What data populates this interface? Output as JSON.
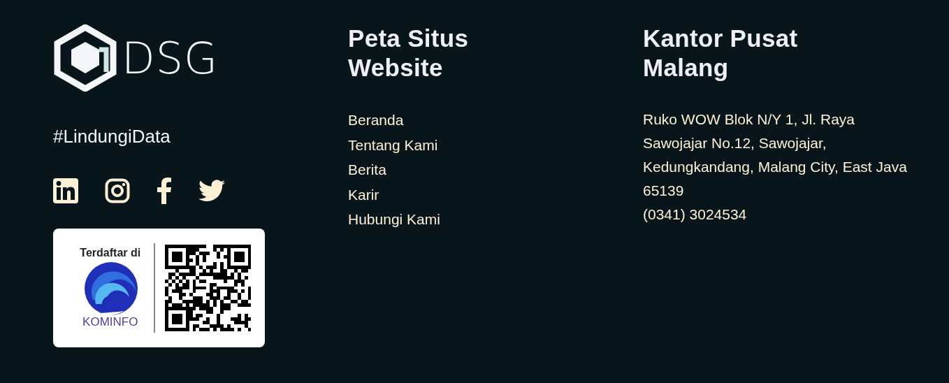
{
  "brand": {
    "logo_text": "DSG",
    "tagline": "#LindungiData",
    "social": [
      {
        "kind": "linkedin"
      },
      {
        "kind": "instagram"
      },
      {
        "kind": "facebook"
      },
      {
        "kind": "twitter"
      }
    ],
    "badge": {
      "caption": "Terdaftar di",
      "agency": "KOMINFO"
    }
  },
  "sitemap": {
    "title": "Peta Situs Website",
    "links": [
      "Beranda",
      "Tentang Kami",
      "Berita",
      "Karir",
      "Hubungi Kami"
    ]
  },
  "office": {
    "title": "Kantor Pusat Malang",
    "address": "Ruko WOW Blok N/Y 1, Jl. Raya Sawojajar No.12, Sawojajar, Kedungkandang, Malang City, East Java 65139",
    "phone": "(0341) 3024534"
  }
}
